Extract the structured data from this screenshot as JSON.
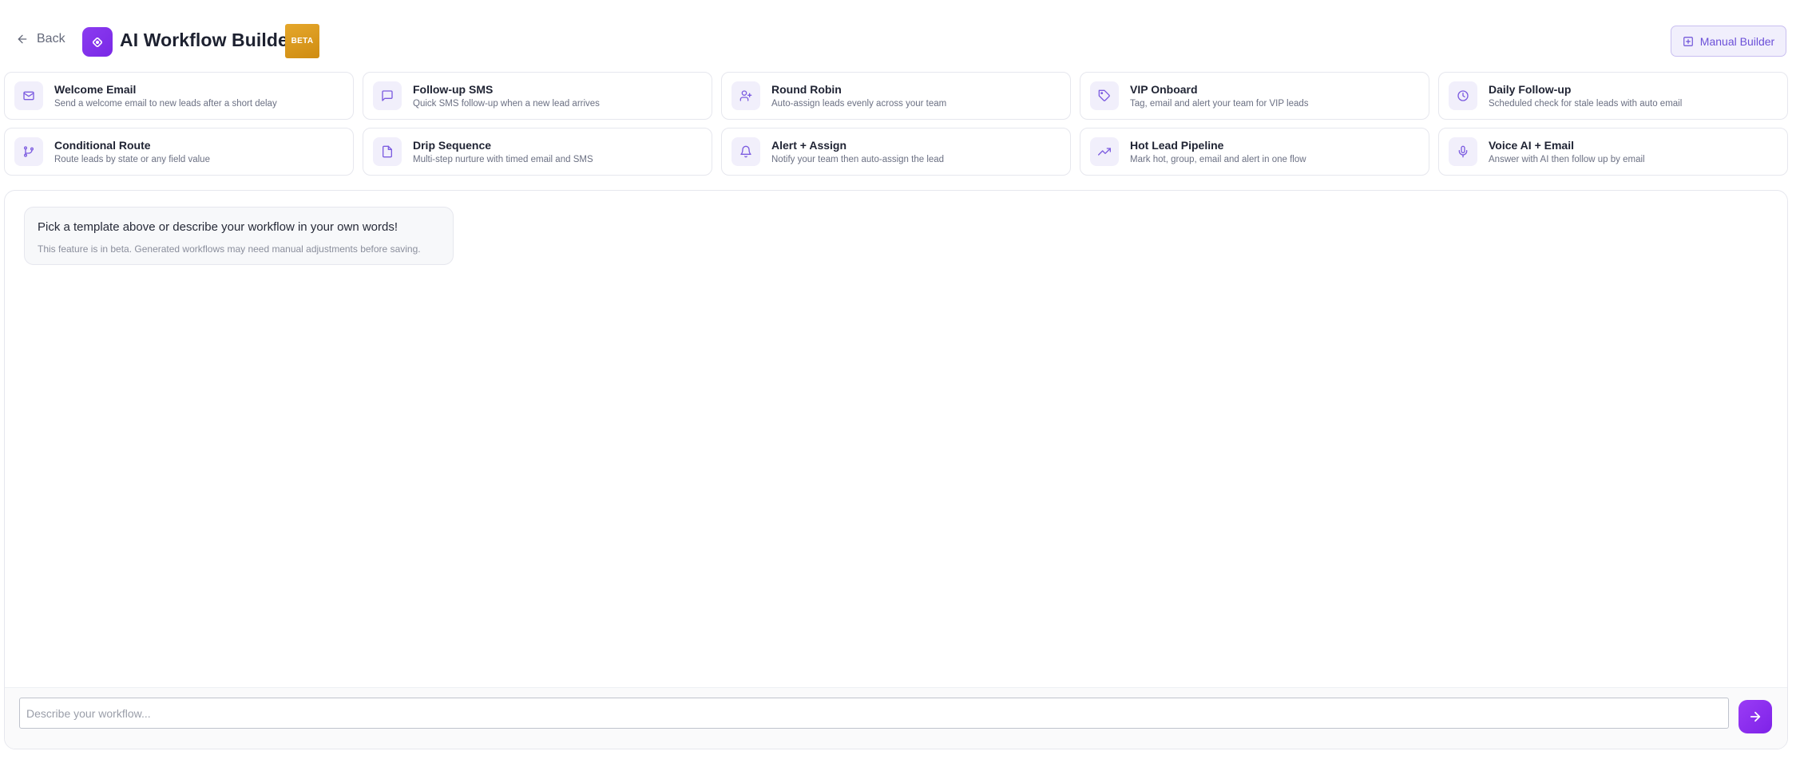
{
  "header": {
    "back_label": "Back",
    "title": "AI Workflow Builder",
    "badge": "BETA",
    "manual_builder_label": "Manual Builder"
  },
  "templates": [
    {
      "name": "Welcome Email",
      "description": "Send a welcome email to new leads after a short delay",
      "icon": "mail-icon"
    },
    {
      "name": "Follow-up SMS",
      "description": "Quick SMS follow-up when a new lead arrives",
      "icon": "message-icon"
    },
    {
      "name": "Round Robin",
      "description": "Auto-assign leads evenly across your team",
      "icon": "user-plus-icon"
    },
    {
      "name": "VIP Onboard",
      "description": "Tag, email and alert your team for VIP leads",
      "icon": "tag-icon"
    },
    {
      "name": "Daily Follow-up",
      "description": "Scheduled check for stale leads with auto email",
      "icon": "clock-icon"
    },
    {
      "name": "Conditional Route",
      "description": "Route leads by state or any field value",
      "icon": "branch-icon"
    },
    {
      "name": "Drip Sequence",
      "description": "Multi-step nurture with timed email and SMS",
      "icon": "file-icon"
    },
    {
      "name": "Alert + Assign",
      "description": "Notify your team then auto-assign the lead",
      "icon": "bell-icon"
    },
    {
      "name": "Hot Lead Pipeline",
      "description": "Mark hot, group, email and alert in one flow",
      "icon": "trending-up-icon"
    },
    {
      "name": "Voice AI + Email",
      "description": "Answer with AI then follow up by email",
      "icon": "mic-icon"
    }
  ],
  "chat": {
    "message": "Pick a template above or describe your workflow in your own words!",
    "note": "This feature is in beta. Generated workflows may need manual adjustments before saving."
  },
  "composer": {
    "placeholder": "Describe your workflow...",
    "value": ""
  },
  "colors": {
    "accent": "#7c3aed",
    "beta_badge": "#d99a1c",
    "icon_tint": "#7c5ce0"
  }
}
